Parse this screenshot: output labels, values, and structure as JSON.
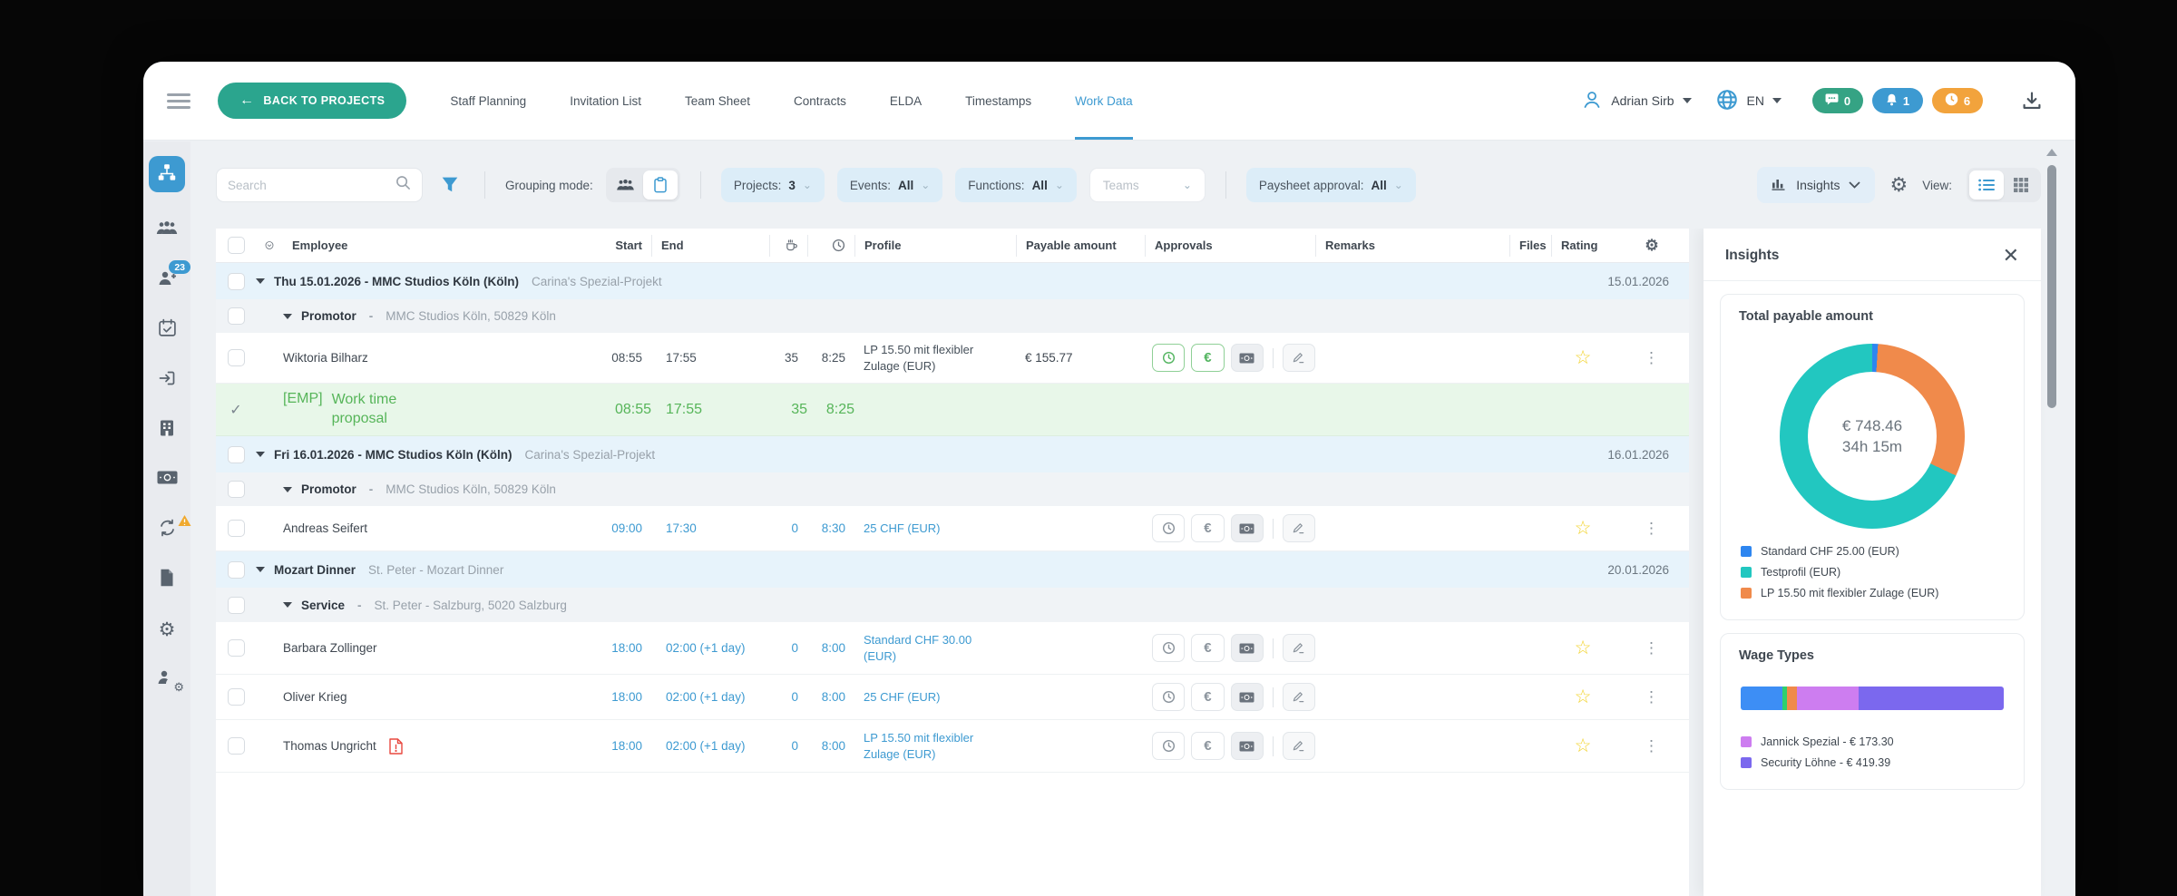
{
  "nav": {
    "back_button": "BACK TO PROJECTS",
    "tabs": [
      "Staff Planning",
      "Invitation List",
      "Team Sheet",
      "Contracts",
      "ELDA",
      "Timestamps",
      "Work Data"
    ],
    "active_tab": "Work Data",
    "user_name": "Adrian Sirb",
    "language": "EN",
    "badges": {
      "messages": "0",
      "notifications": "1",
      "time": "6"
    }
  },
  "toolbar": {
    "search_placeholder": "Search",
    "grouping_mode_label": "Grouping mode:",
    "projects_label": "Projects:",
    "projects_value": "3",
    "events_label": "Events:",
    "events_value": "All",
    "functions_label": "Functions:",
    "functions_value": "All",
    "teams_placeholder": "Teams",
    "paysheet_label": "Paysheet approval:",
    "paysheet_value": "All",
    "insights_button": "Insights",
    "view_label": "View:"
  },
  "table": {
    "headers": {
      "employee": "Employee",
      "start": "Start",
      "end": "End",
      "profile": "Profile",
      "payable": "Payable amount",
      "approvals": "Approvals",
      "remarks": "Remarks",
      "files": "Files",
      "rating": "Rating"
    },
    "rows": [
      {
        "type": "date",
        "title": "Thu 15.01.2026 - MMC Studios Köln (Köln)",
        "subtitle": "Carina's Spezial-Projekt",
        "date": "15.01.2026"
      },
      {
        "type": "function",
        "name": "Promotor",
        "separator": "-",
        "location": "MMC Studios Köln, 50829 Köln"
      },
      {
        "type": "employee",
        "name": "Wiktoria Bilharz",
        "start": "08:55",
        "end": "17:55",
        "break": "35",
        "work_time": "8:25",
        "profile": "LP 15.50 mit flexibler Zulage (EUR)",
        "payable": "€ 155.77"
      },
      {
        "type": "proposal",
        "tag": "[EMP]",
        "label": "Work time proposal",
        "start": "08:55",
        "end": "17:55",
        "break": "35",
        "work_time": "8:25"
      },
      {
        "type": "date",
        "title": "Fri 16.01.2026 - MMC Studios Köln (Köln)",
        "subtitle": "Carina's Spezial-Projekt",
        "date": "16.01.2026"
      },
      {
        "type": "function",
        "name": "Promotor",
        "separator": "-",
        "location": "MMC Studios Köln, 50829 Köln"
      },
      {
        "type": "employee",
        "name": "Andreas Seifert",
        "start": "09:00",
        "end": "17:30",
        "break": "0",
        "work_time": "8:30",
        "profile": "25 CHF (EUR)"
      },
      {
        "type": "date",
        "title": "Mozart Dinner",
        "subtitle": "St. Peter - Mozart Dinner",
        "date": "20.01.2026"
      },
      {
        "type": "function",
        "name": "Service",
        "separator": "-",
        "location": "St. Peter - Salzburg, 5020 Salzburg"
      },
      {
        "type": "employee",
        "name": "Barbara Zollinger",
        "start": "18:00",
        "end": "02:00 (+1 day)",
        "break": "0",
        "work_time": "8:00",
        "profile": "Standard CHF 30.00 (EUR)"
      },
      {
        "type": "employee",
        "name": "Oliver Krieg",
        "start": "18:00",
        "end": "02:00 (+1 day)",
        "break": "0",
        "work_time": "8:00",
        "profile": "25 CHF (EUR)"
      },
      {
        "type": "employee",
        "name": "Thomas Ungricht",
        "start": "18:00",
        "end": "02:00 (+1 day)",
        "break": "0",
        "work_time": "8:00",
        "profile": "LP 15.50 mit flexibler Zulage (EUR)"
      }
    ]
  },
  "insights_panel": {
    "title": "Insights"
  },
  "chart_data": [
    {
      "type": "pie",
      "title": "Total payable amount",
      "center_value": "€ 748.46",
      "center_hours": "34h 15m",
      "segments": [
        {
          "label": "Standard CHF 25.00 (EUR)",
          "color": "#2e86f0",
          "pct": 1
        },
        {
          "label": "LP 15.50 mit flexibler Zulage (EUR)",
          "color": "#f08a4b",
          "pct": 31
        },
        {
          "label": "Testprofil (EUR)",
          "color": "#22c7c0",
          "pct": 68
        }
      ],
      "legend": [
        {
          "label": "Standard CHF 25.00 (EUR)",
          "color": "#2e86f0"
        },
        {
          "label": "Testprofil (EUR)",
          "color": "#22c7c0"
        },
        {
          "label": "LP 15.50 mit flexibler Zulage (EUR)",
          "color": "#f08a4b"
        }
      ]
    },
    {
      "type": "bar",
      "title": "Wage Types",
      "segments": [
        {
          "label": "",
          "color": "#3d8ef5",
          "pct": 16
        },
        {
          "label": "",
          "color": "#2fd06e",
          "pct": 1.5
        },
        {
          "label": "",
          "color": "#f08a4b",
          "pct": 4
        },
        {
          "label": "Jannick Spezial",
          "color": "#cd7df0",
          "pct": 23.5
        },
        {
          "label": "Security Löhne",
          "color": "#7b68ee",
          "pct": 55
        }
      ],
      "legend": [
        {
          "label": "Jannick Spezial - € 173.30",
          "color": "#cd7df0"
        },
        {
          "label": "Security Löhne - € 419.39",
          "color": "#7b68ee"
        }
      ]
    }
  ]
}
